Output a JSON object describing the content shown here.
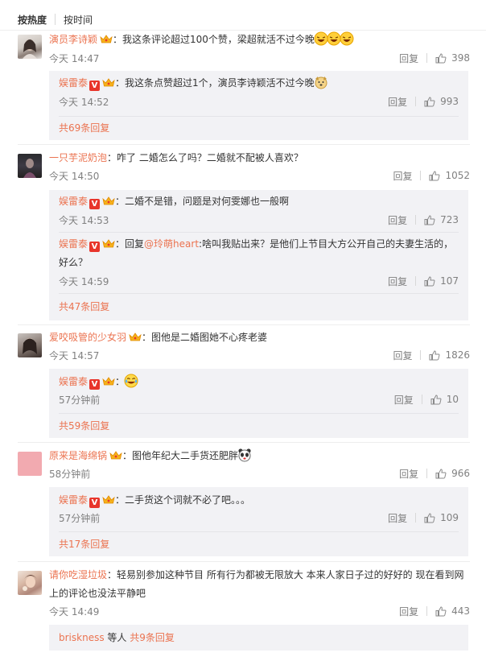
{
  "sort": {
    "hot": "按热度",
    "time": "按时间"
  },
  "labels": {
    "reply": "回复",
    "colon": "："
  },
  "colors": {
    "accent": "#eb7350",
    "subBg": "#f2f2f5",
    "muted": "#808080"
  },
  "icons": [
    "thumbs-up-icon",
    "vip-crown-icon",
    "verified-v-icon",
    "emoji-icon"
  ],
  "comments": [
    {
      "user": "演员李诗颖",
      "text": "我这条评论超过100个赞，梁超就活不过今晚",
      "time": "今天 14:47",
      "likes": "398",
      "replies": [
        {
          "user": "娱雷泰",
          "text": "我这条点赞超过1个，演员李诗颖活不过今晚",
          "time": "今天 14:52",
          "likes": "993"
        }
      ],
      "more": "共69条回复"
    },
    {
      "user": "一只芋泥奶泡",
      "text": "咋了  二婚怎么了吗？二婚就不配被人喜欢？",
      "time": "今天 14:50",
      "likes": "1052",
      "replies": [
        {
          "user": "娱雷泰",
          "text": "二婚不是错，问题是对何雯娜也一般啊",
          "time": "今天 14:53",
          "likes": "723"
        },
        {
          "user": "娱雷泰",
          "prefix": "回复",
          "mention": "@玲萌heart",
          "text": ":啥叫我贴出来？是他们上节目大方公开自己的夫妻生活的，",
          "text2": "好么？",
          "time": "今天 14:59",
          "likes": "107"
        }
      ],
      "more": "共47条回复"
    },
    {
      "user": "爱咬吸管的少女羽",
      "text": "图他是二婚图她不心疼老婆",
      "time": "今天 14:57",
      "likes": "1826",
      "replies": [
        {
          "user": "娱雷泰",
          "text": "",
          "time": "57分钟前",
          "likes": "10"
        }
      ],
      "more": "共59条回复"
    },
    {
      "user": "原来是海绵锅",
      "text": "图他年纪大二手货还肥胖",
      "time": "58分钟前",
      "likes": "966",
      "replies": [
        {
          "user": "娱雷泰",
          "text": "二手货这个词就不必了吧。。。",
          "time": "57分钟前",
          "likes": "109"
        }
      ],
      "more": "共17条回复"
    },
    {
      "user": "请你吃湿垃圾",
      "text": "轻易别参加这种节目 所有行为都被无限放大 本来人家日子过的好好的 现在看到网",
      "text2": "上的评论也没法平静吧",
      "time": "今天 14:49",
      "likes": "443",
      "reply_summary": {
        "user": "briskness",
        "mid": " 等人 ",
        "count": "共9条回复"
      }
    }
  ]
}
